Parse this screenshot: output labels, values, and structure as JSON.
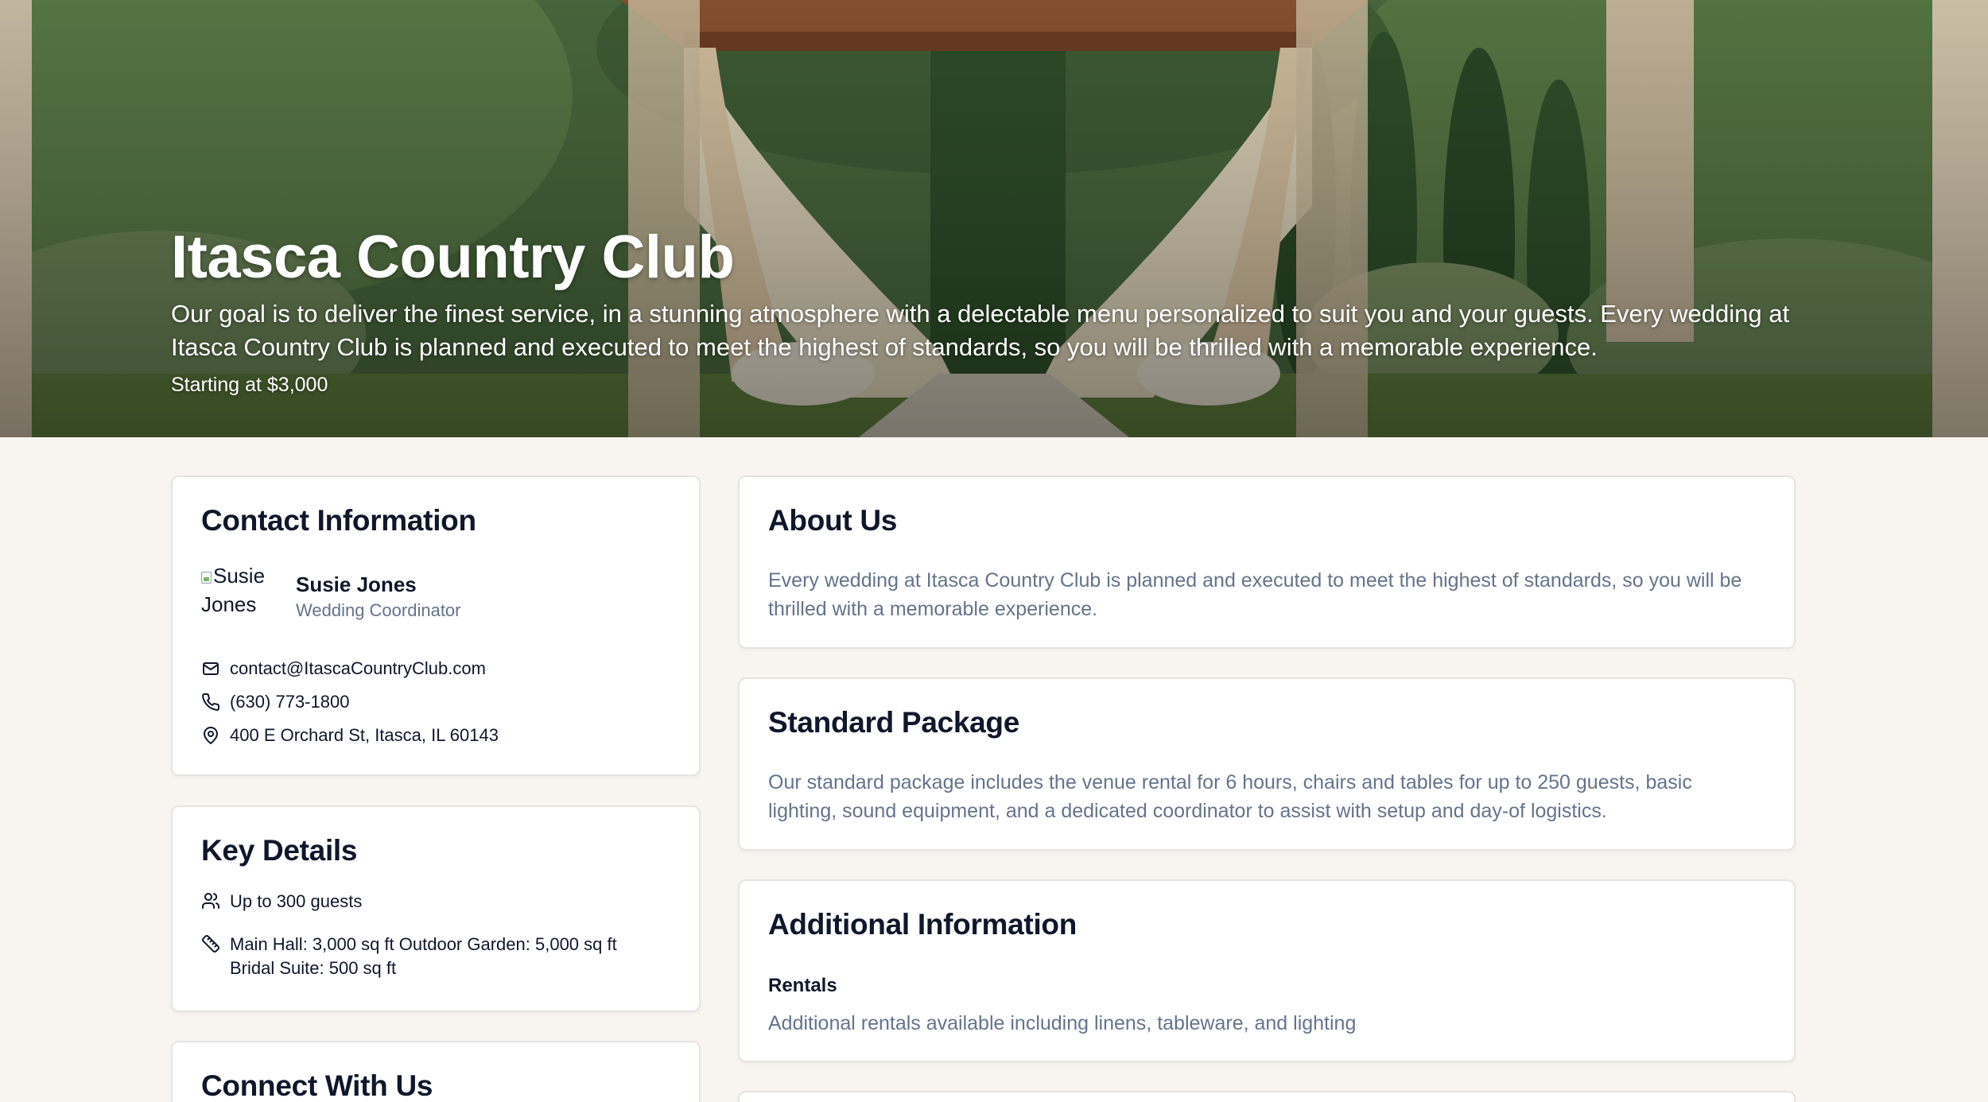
{
  "hero": {
    "title": "Itasca Country Club",
    "description": "Our goal is to deliver the finest service, in a stunning atmosphere with a delectable menu personalized to suit you and your guests. Every wedding at Itasca Country Club is planned and executed to meet the highest of standards, so you will be thrilled with a memorable experience.",
    "price": "Starting at $3,000",
    "image_icon": "wedding-venue-photo"
  },
  "contact": {
    "heading": "Contact Information",
    "avatar_alt": "Susie Jones",
    "name": "Susie Jones",
    "role": "Wedding Coordinator",
    "email": "contact@ItascaCountryClub.com",
    "phone": "(630) 773-1800",
    "address": "400 E Orchard St, Itasca, IL 60143",
    "icons": [
      "mail-icon",
      "phone-icon",
      "map-pin-icon"
    ]
  },
  "details": {
    "heading": "Key Details",
    "capacity": "Up to 300 guests",
    "spaces": "Main Hall: 3,000 sq ft Outdoor Garden: 5,000 sq ft Bridal Suite: 500 sq ft",
    "icons": [
      "users-icon",
      "ruler-icon"
    ]
  },
  "connect": {
    "heading": "Connect With Us"
  },
  "about": {
    "heading": "About Us",
    "text": "Every wedding at Itasca Country Club is planned and executed to meet the highest of standards, so you will be thrilled with a memorable experience."
  },
  "package": {
    "heading": "Standard Package",
    "text": "Our standard package includes the venue rental for 6 hours, chairs and tables for up to 250 guests, basic lighting, sound equipment, and a dedicated coordinator to assist with setup and day-of logistics."
  },
  "additional": {
    "heading": "Additional Information",
    "subheading": "Rentals",
    "text": "Additional rentals available including linens, tableware, and lighting"
  },
  "colors": {
    "page_background": "#f8f5f1",
    "card_border": "#e7e3de",
    "heading_text": "#0f172a",
    "muted_text": "#64748b"
  }
}
